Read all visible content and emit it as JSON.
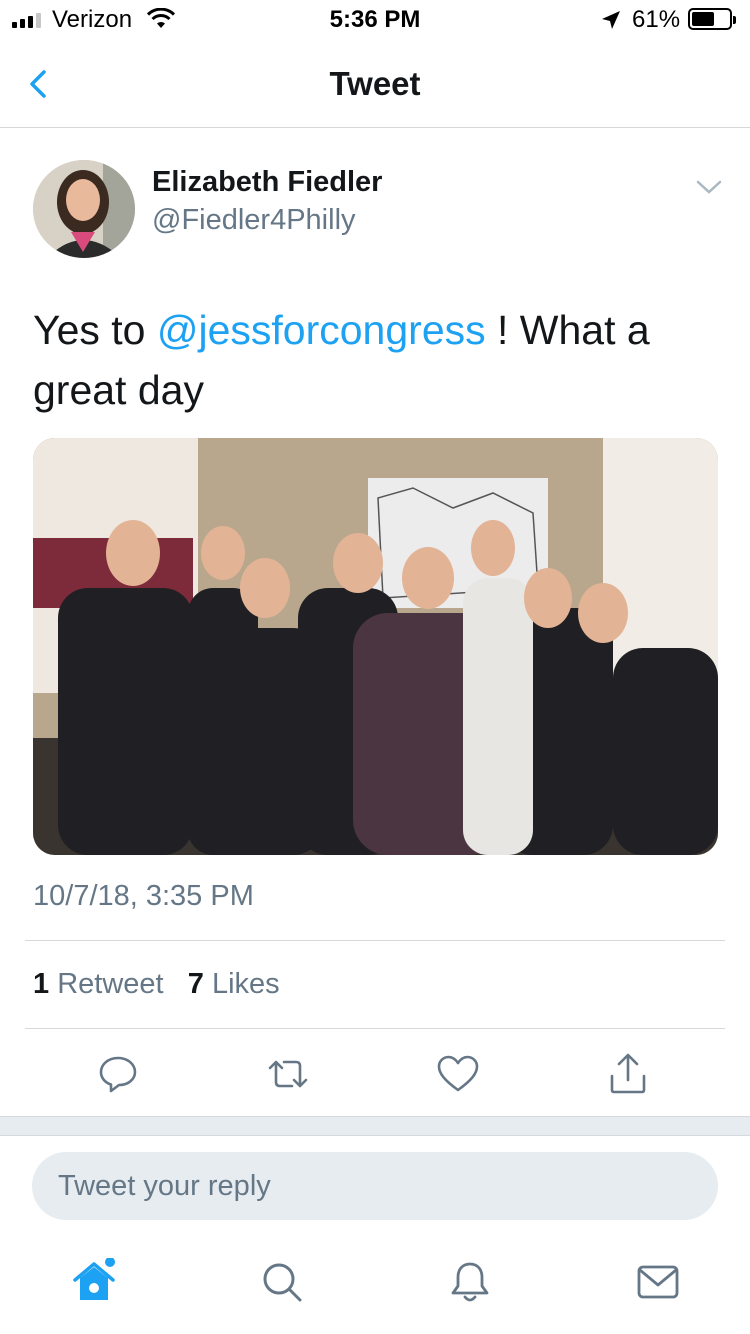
{
  "status_bar": {
    "carrier": "Verizon",
    "time": "5:36 PM",
    "battery_percent": "61%",
    "battery_level": 0.61
  },
  "nav": {
    "title": "Tweet",
    "back_icon": "chevron-left-icon"
  },
  "tweet": {
    "display_name": "Elizabeth Fiedler",
    "handle": "@Fiedler4Philly",
    "text_before": "Yes to ",
    "mention": "@jessforcongress",
    "text_after": " ! What a great day",
    "timestamp": "10/7/18, 3:35 PM",
    "retweet_count": "1",
    "retweet_label": "Retweet",
    "like_count": "7",
    "like_label": "Likes"
  },
  "actions": [
    {
      "name": "reply-icon"
    },
    {
      "name": "retweet-icon"
    },
    {
      "name": "like-icon"
    },
    {
      "name": "share-icon"
    }
  ],
  "reply": {
    "placeholder": "Tweet your reply"
  },
  "tabs": [
    {
      "name": "home-icon",
      "active": true
    },
    {
      "name": "search-icon",
      "active": false
    },
    {
      "name": "notifications-icon",
      "active": false
    },
    {
      "name": "messages-icon",
      "active": false
    }
  ],
  "colors": {
    "accent": "#1da1f2",
    "secondary_text": "#657786",
    "primary_text": "#14171a"
  }
}
